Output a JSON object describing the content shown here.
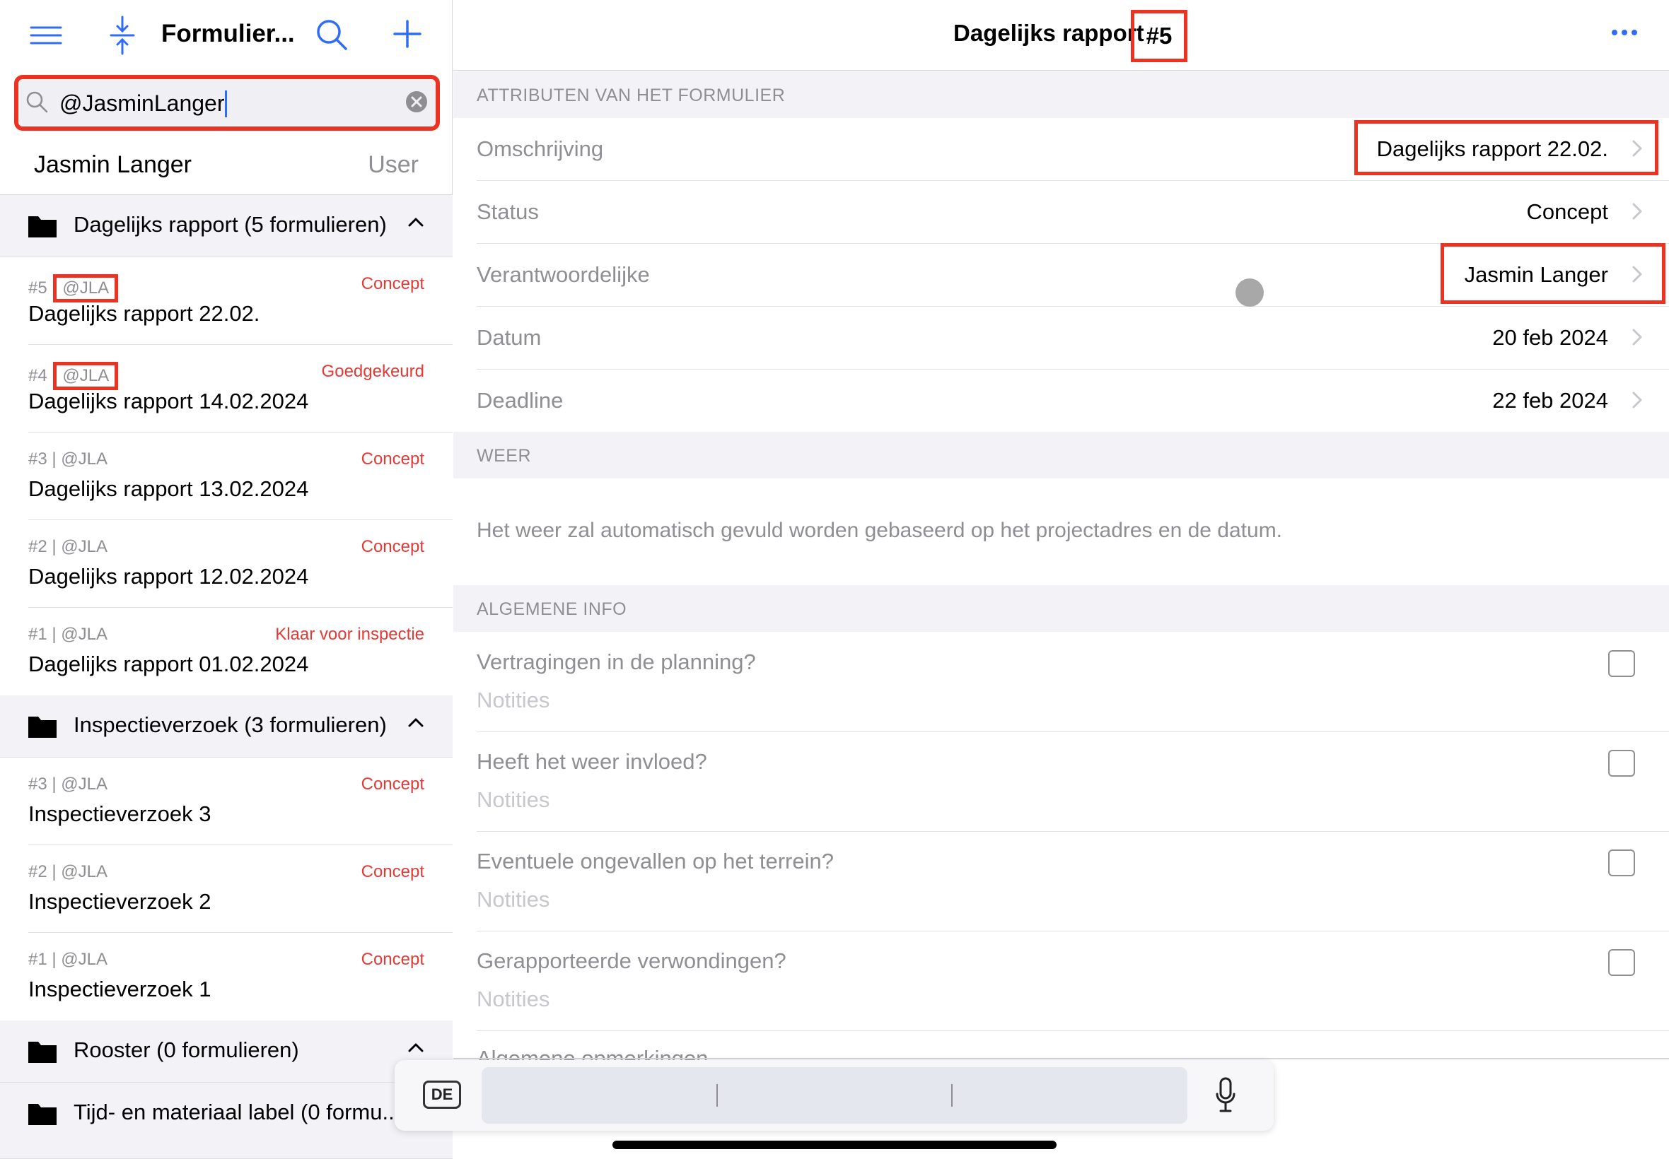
{
  "sidebar": {
    "title": "Formulier...",
    "search": {
      "value": "@JasminLanger"
    },
    "suggestion": {
      "name": "Jasmin Langer",
      "tag": "User"
    },
    "groups": [
      {
        "title": "Dagelijks rapport (5 formulieren)",
        "items": [
          {
            "num": "#5",
            "user": "@JLA",
            "status": "Concept",
            "title": "Dagelijks rapport 22.02."
          },
          {
            "num": "#4",
            "user": "@JLA",
            "status": "Goedgekeurd",
            "title": "Dagelijks rapport 14.02.2024"
          },
          {
            "num": "#3",
            "user": "@JLA",
            "status": "Concept",
            "title": "Dagelijks rapport 13.02.2024"
          },
          {
            "num": "#2",
            "user": "@JLA",
            "status": "Concept",
            "title": "Dagelijks rapport 12.02.2024"
          },
          {
            "num": "#1",
            "user": "@JLA",
            "status": "Klaar voor inspectie",
            "title": "Dagelijks rapport 01.02.2024"
          }
        ]
      },
      {
        "title": "Inspectieverzoek (3 formulieren)",
        "items": [
          {
            "num": "#3",
            "user": "@JLA",
            "status": "Concept",
            "title": "Inspectieverzoek 3"
          },
          {
            "num": "#2",
            "user": "@JLA",
            "status": "Concept",
            "title": "Inspectieverzoek 2"
          },
          {
            "num": "#1",
            "user": "@JLA",
            "status": "Concept",
            "title": "Inspectieverzoek 1"
          }
        ]
      },
      {
        "title": "Rooster (0 formulieren)",
        "items": []
      },
      {
        "title": "Tijd- en materiaal label (0 formu...",
        "items": []
      }
    ],
    "sep": " | "
  },
  "detail": {
    "title": "Dagelijks rapport",
    "number": "#5",
    "sections": {
      "attributes": "ATTRIBUTEN VAN HET FORMULIER",
      "weather": "WEER",
      "general": "ALGEMENE INFO"
    },
    "fields": [
      {
        "label": "Omschrijving",
        "value": "Dagelijks rapport 22.02."
      },
      {
        "label": "Status",
        "value": "Concept"
      },
      {
        "label": "Verantwoordelijke",
        "value": "Jasmin Langer"
      },
      {
        "label": "Datum",
        "value": "20 feb 2024"
      },
      {
        "label": "Deadline",
        "value": "22 feb 2024"
      }
    ],
    "weather_info": "Het weer zal automatisch gevuld worden gebaseerd op het projectadres en de datum.",
    "questions": [
      {
        "q": "Vertragingen in de planning?",
        "notes": "Notities"
      },
      {
        "q": "Heeft het weer invloed?",
        "notes": "Notities"
      },
      {
        "q": "Eventuele ongevallen op het terrein?",
        "notes": "Notities"
      },
      {
        "q": "Gerapporteerde verwondingen?",
        "notes": "Notities"
      }
    ],
    "cut_off_text": "Algemene opmerkingen"
  },
  "keyboard": {
    "language": "DE"
  },
  "colors": {
    "accent": "#2f6df6",
    "status_red": "#e53935",
    "highlight_red": "#ea3323"
  }
}
